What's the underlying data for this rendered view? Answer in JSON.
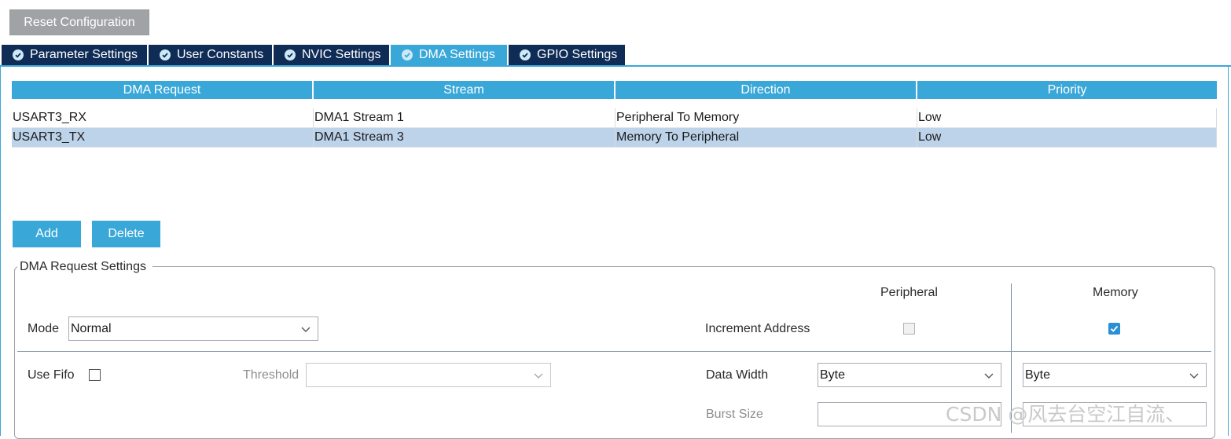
{
  "toolbar": {
    "reset_label": "Reset Configuration"
  },
  "tabs": [
    {
      "label": "Parameter Settings",
      "active": false
    },
    {
      "label": "User Constants",
      "active": false
    },
    {
      "label": "NVIC Settings",
      "active": false
    },
    {
      "label": "DMA Settings",
      "active": true
    },
    {
      "label": "GPIO Settings",
      "active": false
    }
  ],
  "table": {
    "columns": [
      "DMA Request",
      "Stream",
      "Direction",
      "Priority"
    ],
    "rows": [
      [
        "USART3_RX",
        "DMA1 Stream 1",
        "Peripheral To Memory",
        "Low"
      ],
      [
        "USART3_TX",
        "DMA1 Stream 3",
        "Memory To Peripheral",
        "Low"
      ]
    ],
    "selected_row": 1
  },
  "actions": {
    "add_label": "Add",
    "delete_label": "Delete"
  },
  "settings": {
    "title": "DMA Request Settings",
    "peripheral_header": "Peripheral",
    "memory_header": "Memory",
    "mode_label": "Mode",
    "mode_value": "Normal",
    "increment_address_label": "Increment Address",
    "peripheral_increment": false,
    "memory_increment": true,
    "use_fifo_label": "Use Fifo",
    "use_fifo": false,
    "threshold_label": "Threshold",
    "threshold_value": "",
    "data_width_label": "Data Width",
    "peripheral_data_width": "Byte",
    "memory_data_width": "Byte",
    "burst_size_label": "Burst Size"
  },
  "watermark": "CSDN @风去台空江自流、",
  "colors": {
    "accent": "#3aa7d9",
    "tab_bg": "#0f2c57",
    "selected_row": "#bdd3ea",
    "reset_button": "#a0a3a6",
    "checkbox_checked": "#2b8fd6"
  }
}
